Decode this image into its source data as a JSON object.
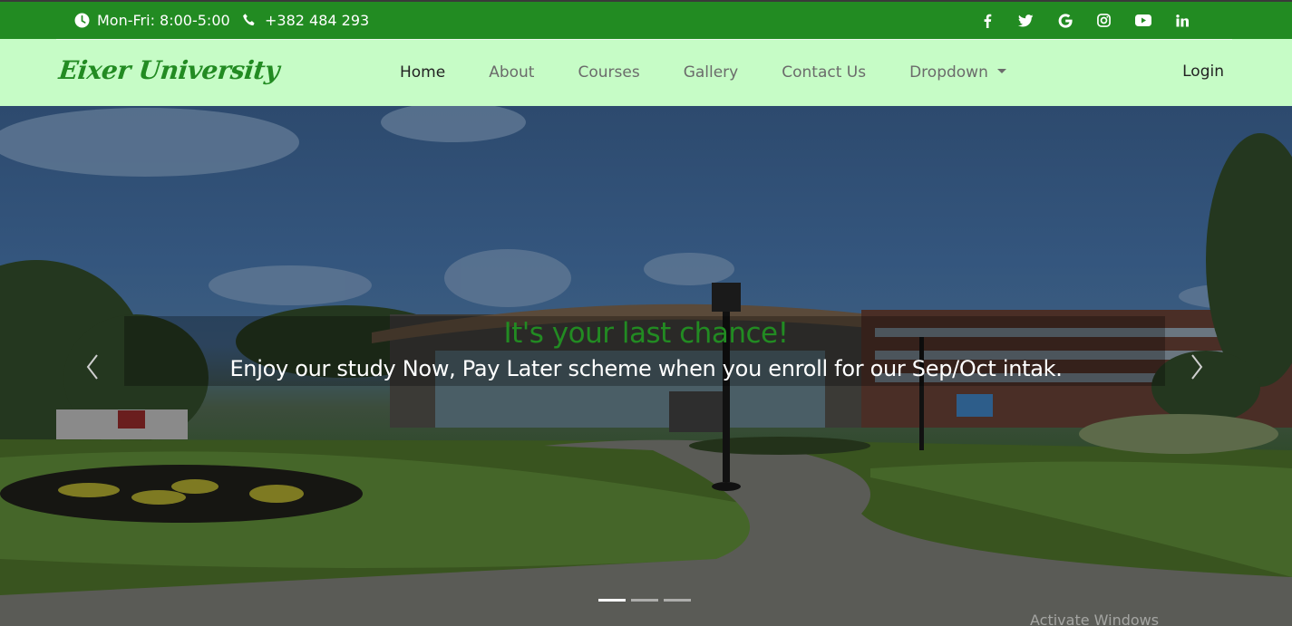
{
  "topbar": {
    "hours": "Mon-Fri: 8:00-5:00",
    "phone": "+382 484 293",
    "socials": [
      {
        "icon": "facebook-icon",
        "glyph": "f"
      },
      {
        "icon": "twitter-icon",
        "glyph": "t"
      },
      {
        "icon": "google-icon",
        "glyph": "G"
      },
      {
        "icon": "instagram-icon",
        "glyph": "ig"
      },
      {
        "icon": "youtube-icon",
        "glyph": "yt"
      },
      {
        "icon": "linkedin-icon",
        "glyph": "in"
      }
    ]
  },
  "nav": {
    "brand": "Eixer University",
    "items": [
      "Home",
      "About",
      "Courses",
      "Gallery",
      "Contact Us",
      "Dropdown"
    ],
    "active": "Home",
    "login": "Login"
  },
  "hero": {
    "title": "It's your last chance!",
    "text": "Enjoy our study Now, Pay Later scheme when you enroll for our Sep/Oct intak.",
    "slide_count": 3,
    "active_slide": 1
  },
  "watermark": "Activate Windows",
  "colors": {
    "primary": "#228b22",
    "nav_bg": "#c6fcc6"
  }
}
